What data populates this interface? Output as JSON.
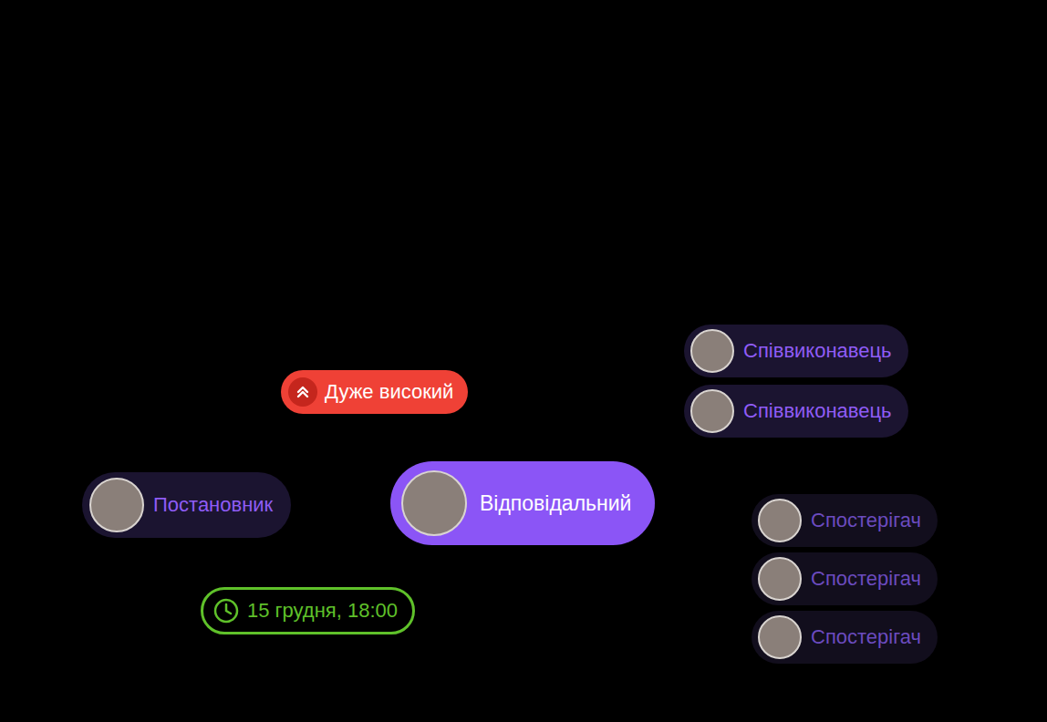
{
  "priority": {
    "label": "Дуже високий"
  },
  "author": {
    "label": "Постановник"
  },
  "responsible": {
    "label": "Відповідальний"
  },
  "co_executors": [
    {
      "label": "Співвиконавець"
    },
    {
      "label": "Співвиконавець"
    }
  ],
  "observers": [
    {
      "label": "Спостерігач"
    },
    {
      "label": "Спостерігач"
    },
    {
      "label": "Спостерігач"
    }
  ],
  "deadline": {
    "label": "15 грудня, 18:00"
  }
}
